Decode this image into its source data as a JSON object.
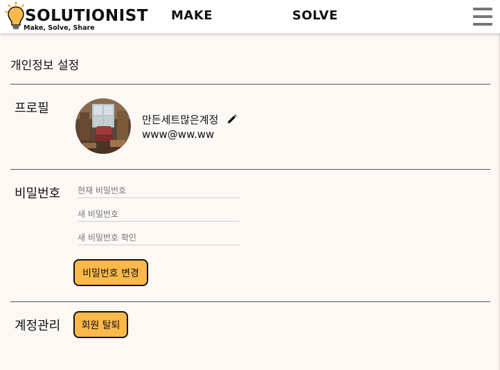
{
  "header": {
    "logo_word": "SOLUTIONIST",
    "logo_tagline": "Make, Solve, Share",
    "nav": [
      {
        "label": "MAKE"
      },
      {
        "label": "SOLVE"
      }
    ],
    "menu_icon": "hamburger-menu-icon"
  },
  "page": {
    "title": "개인정보 설정"
  },
  "profile": {
    "section_label": "프로필",
    "name": "만든세트많은계정",
    "email": "www@ww.ww",
    "edit_icon": "pencil-icon"
  },
  "password": {
    "section_label": "비밀번호",
    "current_placeholder": "현재 비밀번호",
    "new_placeholder": "새 비밀번호",
    "confirm_placeholder": "새 비밀번호 확인",
    "change_button": "비밀번호 변경"
  },
  "account": {
    "section_label": "계정관리",
    "withdraw_button": "회원 탈퇴"
  },
  "colors": {
    "accent": "#fdb84a",
    "background": "#fdf8f3"
  }
}
